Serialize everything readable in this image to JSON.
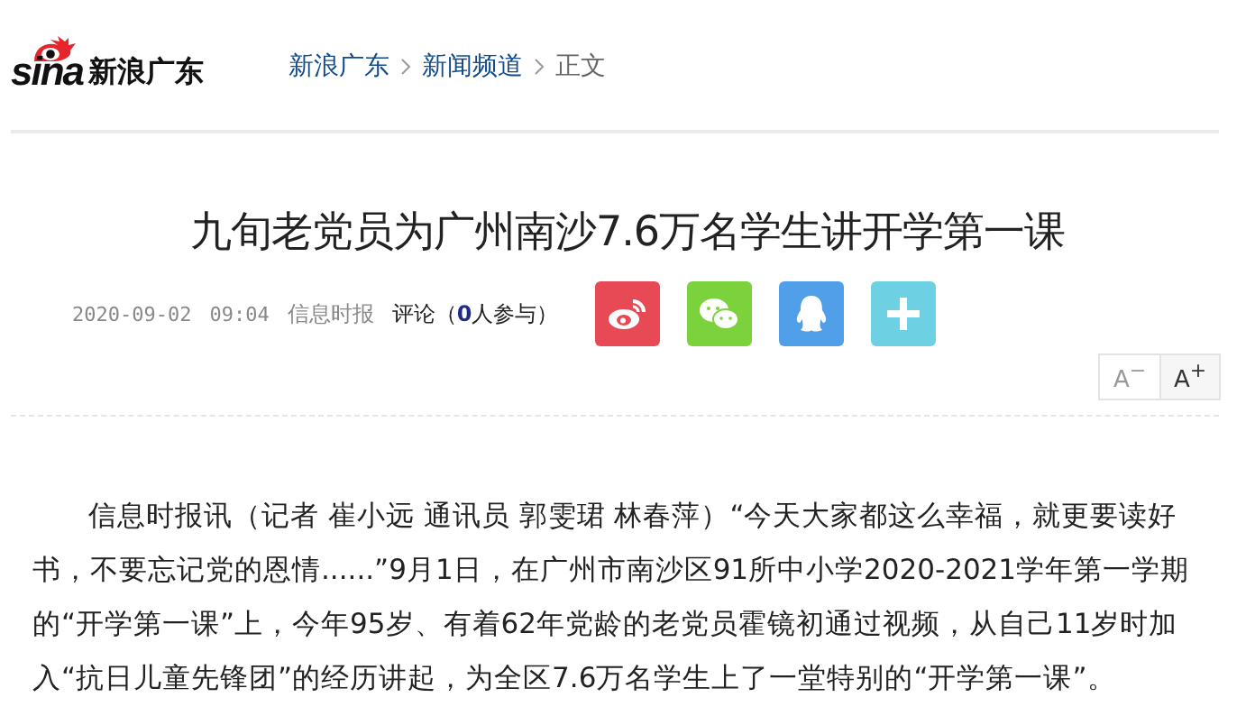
{
  "header": {
    "logo": {
      "brand": "sina",
      "name": "新浪广东"
    },
    "breadcrumb": [
      {
        "label": "新浪广东",
        "kind": "link"
      },
      {
        "label": "新闻频道",
        "kind": "link"
      },
      {
        "label": "正文",
        "kind": "current"
      }
    ]
  },
  "article": {
    "title": "九旬老党员为广州南沙7.6万名学生讲开学第一课",
    "meta": {
      "date": "2020-09-02",
      "time": "09:04",
      "source": "信息时报",
      "comments": "评论（**0**人参与）"
    },
    "share": [
      {
        "kind": "weibo",
        "color": "#e84a55"
      },
      {
        "kind": "wechat",
        "color": "#7bd23c"
      },
      {
        "kind": "qq",
        "color": "#519fe8"
      },
      {
        "kind": "more",
        "color": "#6dd0e3"
      }
    ],
    "font_buttons": [
      {
        "label": "A",
        "sign": "−"
      },
      {
        "label": "A",
        "sign": "+"
      }
    ],
    "body": "信息时报讯（记者 崔小远 通讯员 郭雯珺 林春萍）“今天大家都这么幸福，就更要读好书，不要忘记党的恩情......”9月1日，在广州市南沙区91所中小学2020-2021学年第一学期的“开学第一课”上，今年95岁、有着62年党龄的老党员霍镜初通过视频，从自己11岁时加入“抗日儿童先锋团”的经历讲起，为全区7.6万名学生上了一堂特别的“开学第一课”。"
  }
}
